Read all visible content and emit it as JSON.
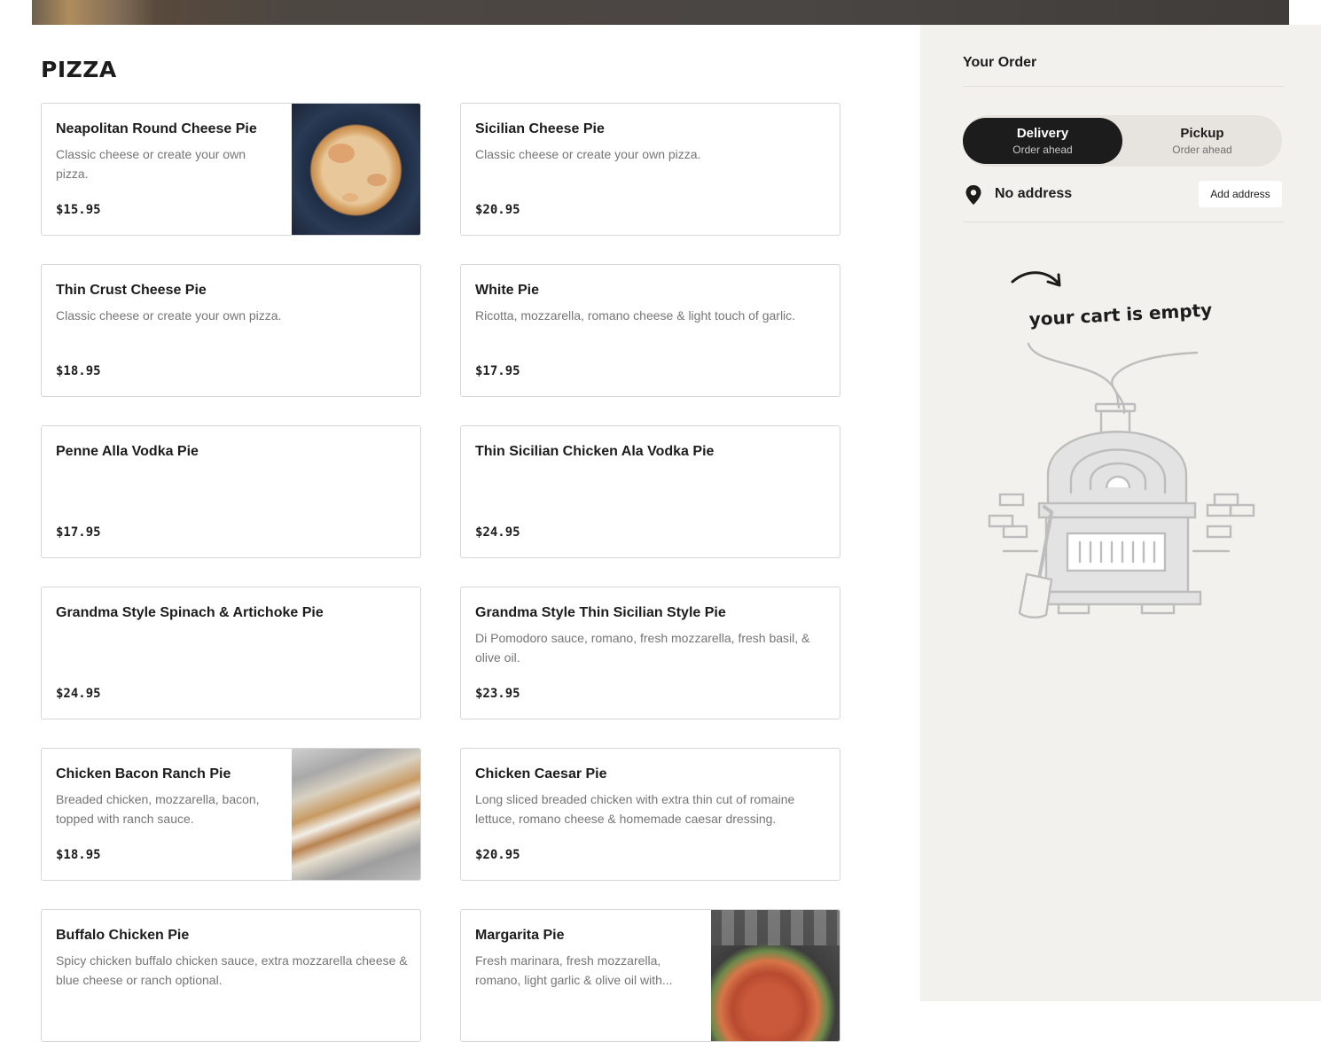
{
  "section": {
    "title": "PIZZA"
  },
  "menu_items": [
    {
      "name": "Neapolitan Round Cheese Pie",
      "description": "Classic cheese or create your own pizza.",
      "price": "$15.95",
      "has_image": true
    },
    {
      "name": "Sicilian Cheese Pie",
      "description": "Classic cheese or create your own pizza.",
      "price": "$20.95",
      "has_image": false
    },
    {
      "name": "Thin Crust Cheese Pie",
      "description": "Classic cheese or create your own pizza.",
      "price": "$18.95",
      "has_image": false
    },
    {
      "name": "White Pie",
      "description": "Ricotta, mozzarella, romano cheese & light touch of garlic.",
      "price": "$17.95",
      "has_image": false
    },
    {
      "name": "Penne Alla Vodka Pie",
      "description": "",
      "price": "$17.95",
      "has_image": false
    },
    {
      "name": "Thin Sicilian Chicken Ala Vodka Pie",
      "description": "",
      "price": "$24.95",
      "has_image": false
    },
    {
      "name": "Grandma Style Spinach & Artichoke Pie",
      "description": "",
      "price": "$24.95",
      "has_image": false
    },
    {
      "name": "Grandma Style Thin Sicilian Style Pie",
      "description": "Di Pomodoro sauce, romano, fresh mozzarella, fresh basil, & olive oil.",
      "price": "$23.95",
      "has_image": false
    },
    {
      "name": "Chicken Bacon Ranch Pie",
      "description": "Breaded chicken, mozzarella, bacon, topped with ranch sauce.",
      "price": "$18.95",
      "has_image": true
    },
    {
      "name": "Chicken Caesar Pie",
      "description": "Long sliced breaded chicken with extra thin cut of romaine lettuce, romano cheese & homemade caesar dressing.",
      "price": "$20.95",
      "has_image": false
    },
    {
      "name": "Buffalo Chicken Pie",
      "description": "Spicy chicken buffalo chicken sauce, extra mozzarella cheese & blue cheese or ranch optional.",
      "price": "",
      "has_image": false
    },
    {
      "name": "Margarita Pie",
      "description": "Fresh marinara, fresh mozzarella, romano, light garlic & olive oil with...",
      "price": "",
      "has_image": true
    }
  ],
  "order": {
    "title": "Your Order",
    "delivery": {
      "label": "Delivery",
      "sub": "Order ahead",
      "selected": true
    },
    "pickup": {
      "label": "Pickup",
      "sub": "Order ahead",
      "selected": false
    },
    "address": "No address",
    "add_address_label": "Add address",
    "empty_cart_text": "your cart is empty"
  },
  "colors": {
    "accent": "#1c1c1c",
    "sidebar_bg": "#f3f1ee",
    "muted_text": "#757575"
  },
  "icons": [
    "location-pin-icon",
    "arrow-icon",
    "pizza-oven-illustration"
  ]
}
